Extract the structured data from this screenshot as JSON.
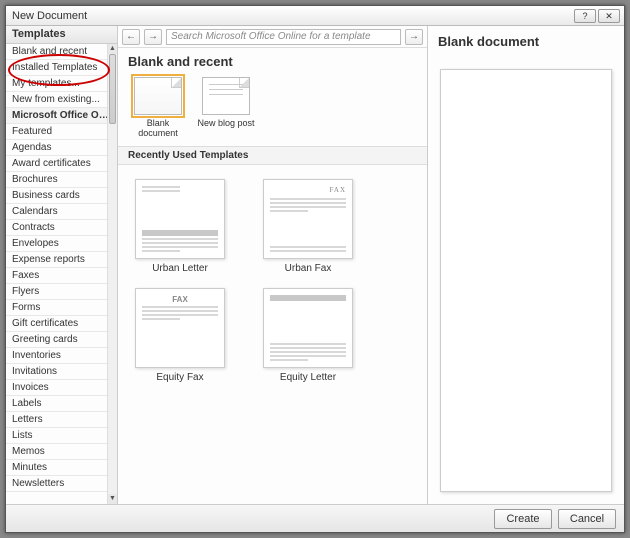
{
  "window": {
    "title": "New Document"
  },
  "sidebar": {
    "header": "Templates",
    "items": [
      {
        "label": "Blank and recent",
        "section": false
      },
      {
        "label": "Installed Templates",
        "section": false
      },
      {
        "label": "My templates...",
        "section": false
      },
      {
        "label": "New from existing...",
        "section": false
      },
      {
        "label": "Microsoft Office Online",
        "section": true
      },
      {
        "label": "Featured",
        "section": false
      },
      {
        "label": "Agendas",
        "section": false
      },
      {
        "label": "Award certificates",
        "section": false
      },
      {
        "label": "Brochures",
        "section": false
      },
      {
        "label": "Business cards",
        "section": false
      },
      {
        "label": "Calendars",
        "section": false
      },
      {
        "label": "Contracts",
        "section": false
      },
      {
        "label": "Envelopes",
        "section": false
      },
      {
        "label": "Expense reports",
        "section": false
      },
      {
        "label": "Faxes",
        "section": false
      },
      {
        "label": "Flyers",
        "section": false
      },
      {
        "label": "Forms",
        "section": false
      },
      {
        "label": "Gift certificates",
        "section": false
      },
      {
        "label": "Greeting cards",
        "section": false
      },
      {
        "label": "Inventories",
        "section": false
      },
      {
        "label": "Invitations",
        "section": false
      },
      {
        "label": "Invoices",
        "section": false
      },
      {
        "label": "Labels",
        "section": false
      },
      {
        "label": "Letters",
        "section": false
      },
      {
        "label": "Lists",
        "section": false
      },
      {
        "label": "Memos",
        "section": false
      },
      {
        "label": "Minutes",
        "section": false
      },
      {
        "label": "Newsletters",
        "section": false
      }
    ]
  },
  "toolbar": {
    "back": "←",
    "forward": "→",
    "search_placeholder": "Search Microsoft Office Online for a template",
    "go": "→"
  },
  "main": {
    "header": "Blank and recent",
    "tiles": [
      {
        "label": "Blank document",
        "selected": true
      },
      {
        "label": "New blog post",
        "selected": false
      }
    ],
    "recent_header": "Recently Used Templates",
    "templates": [
      {
        "label": "Urban Letter",
        "kind": "letter"
      },
      {
        "label": "Urban Fax",
        "kind": "fax-serif"
      },
      {
        "label": "Equity Fax",
        "kind": "fax-bold"
      },
      {
        "label": "Equity Letter",
        "kind": "letter-block"
      }
    ]
  },
  "preview": {
    "header": "Blank document"
  },
  "footer": {
    "create": "Create",
    "cancel": "Cancel"
  }
}
